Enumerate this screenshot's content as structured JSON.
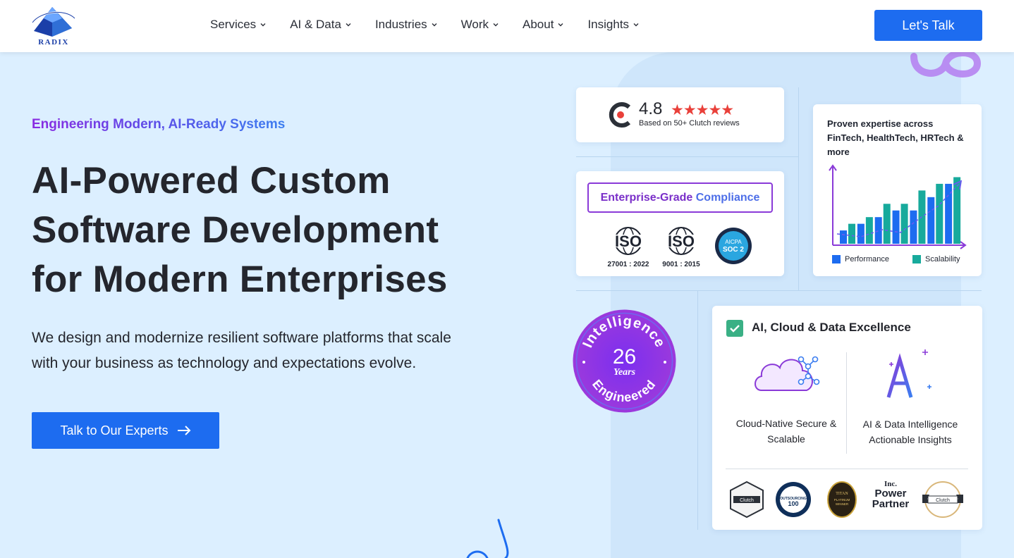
{
  "brand": {
    "name": "RADIX"
  },
  "nav": {
    "items": [
      {
        "label": "Services"
      },
      {
        "label": "AI & Data"
      },
      {
        "label": "Industries"
      },
      {
        "label": "Work"
      },
      {
        "label": "About"
      },
      {
        "label": "Insights"
      }
    ],
    "cta_label": "Let's Talk"
  },
  "hero": {
    "tagline": "Engineering Modern, AI-Ready Systems",
    "title_lines": [
      "AI-Powered Custom",
      "Software Development",
      "for Modern Enterprises"
    ],
    "lead_lines": [
      "We design and modernize resilient software platforms that scale",
      "with your business as technology and expectations evolve."
    ],
    "button_label": "Talk to Our Experts"
  },
  "rating": {
    "score": "4.8",
    "stars": 5,
    "subtext": "Based on 50+ Clutch reviews",
    "icon": "clutch-logo-icon"
  },
  "compliance": {
    "title_part1": "Enterprise-Grade",
    "title_part2": "Compliance",
    "certs": [
      {
        "name": "ISO",
        "label": "27001 : 2022"
      },
      {
        "name": "ISO",
        "label": "9001 : 2015"
      },
      {
        "name": "AICPA SOC 2",
        "label": ""
      }
    ]
  },
  "expertise": {
    "title": "Proven expertise across FinTech, HealthTech, HRTech & more",
    "chart_data": {
      "type": "bar",
      "series": [
        {
          "name": "Performance",
          "color": "#1d6cf0",
          "values": [
            2,
            3,
            4,
            5,
            5,
            7,
            9
          ]
        },
        {
          "name": "Scalability",
          "color": "#17aa9c",
          "values": [
            3,
            4,
            6,
            6,
            8,
            9,
            10
          ]
        }
      ],
      "trend": "dashed-arrow-up",
      "grid": false
    },
    "legend": [
      {
        "label": "Performance",
        "color": "#1d6cf0"
      },
      {
        "label": "Scalability",
        "color": "#17aa9c"
      }
    ]
  },
  "excellence": {
    "title": "AI, Cloud & Data Excellence",
    "features": [
      {
        "icon": "cloud-network-icon",
        "line1": "Cloud-Native Secure &",
        "line2": "Scalable"
      },
      {
        "icon": "ai-sparkle-icon",
        "line1": "AI & Data Intelligence",
        "line2": "Actionable Insights"
      }
    ],
    "awards": [
      {
        "icon": "clutch-award-badge",
        "text": "Clutch"
      },
      {
        "icon": "outsourcing-100-badge",
        "text": "OUTSOURCING 100"
      },
      {
        "icon": "titan-platinum-badge",
        "text": "TITAN PLATINUM WINNER"
      },
      {
        "icon": "inc-power-partner-badge",
        "brand": "Inc.",
        "line1": "Power",
        "line2": "Partner"
      },
      {
        "icon": "clutch-global-badge",
        "text": "Clutch"
      }
    ]
  },
  "seal": {
    "top_text": "Intelligence",
    "number": "26",
    "unit": "Years",
    "bottom_text": "Engineered"
  },
  "colors": {
    "accent": "#1d6cf0",
    "background": "#dcefff",
    "purple": "#8a3ad8",
    "teal": "#17aa9c"
  }
}
